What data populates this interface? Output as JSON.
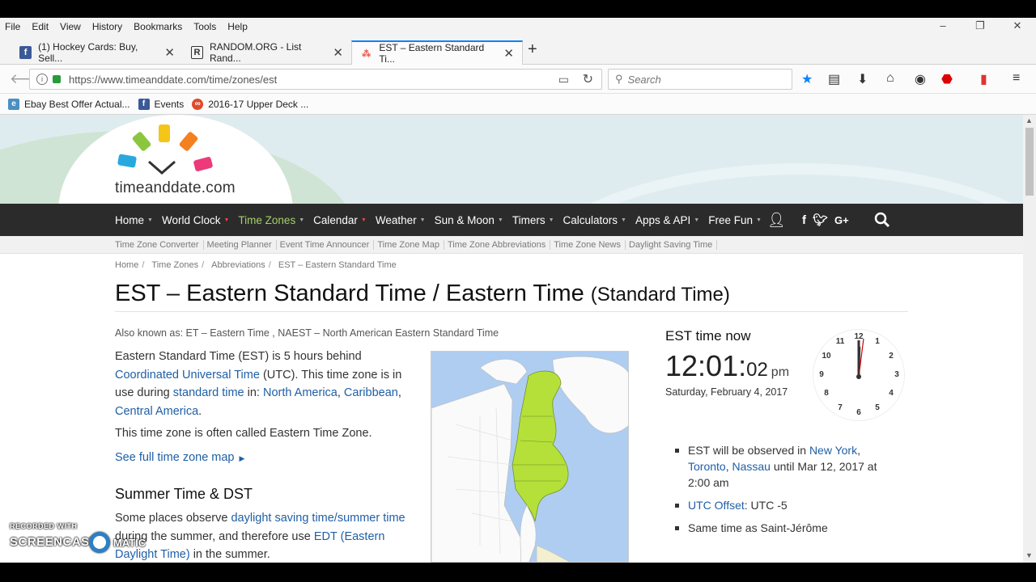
{
  "menubar": {
    "items": [
      "File",
      "Edit",
      "View",
      "History",
      "Bookmarks",
      "Tools",
      "Help"
    ]
  },
  "window_controls": {
    "minimize": "–",
    "restore": "❐",
    "close": "✕"
  },
  "tabs": [
    {
      "label": "(1) Hockey Cards: Buy, Sell...",
      "favicon": "facebook-icon"
    },
    {
      "label": "RANDOM.ORG - List Rand...",
      "favicon": "random-org-icon"
    },
    {
      "label": "EST – Eastern Standard Ti...",
      "favicon": "timeanddate-icon",
      "active": true
    }
  ],
  "navbar": {
    "url": "https://www.timeanddate.com/time/zones/est",
    "search_placeholder": "Search"
  },
  "bookmarks": [
    {
      "label": "Ebay Best Offer Actual...",
      "icon": "ebay-icon"
    },
    {
      "label": "Events",
      "icon": "facebook-icon"
    },
    {
      "label": "2016-17 Upper Deck ...",
      "icon": "upper-deck-icon"
    }
  ],
  "site": {
    "logo_text": "timeanddate.com",
    "nav": [
      {
        "label": "Home"
      },
      {
        "label": "World Clock"
      },
      {
        "label": "Time Zones",
        "active": true
      },
      {
        "label": "Calendar"
      },
      {
        "label": "Weather"
      },
      {
        "label": "Sun & Moon"
      },
      {
        "label": "Timers"
      },
      {
        "label": "Calculators"
      },
      {
        "label": "Apps & API"
      },
      {
        "label": "Free Fun"
      }
    ],
    "subnav": [
      "Time Zone Converter",
      "Meeting Planner",
      "Event Time Announcer",
      "Time Zone Map",
      "Time Zone Abbreviations",
      "Time Zone News",
      "Daylight Saving Time"
    ]
  },
  "breadcrumbs": [
    "Home",
    "Time Zones",
    "Abbreviations",
    "EST – Eastern Standard Time"
  ],
  "page": {
    "title": "EST – Eastern Standard Time / Eastern Time",
    "title_sub": "(Standard Time)",
    "aka": "Also known as: ET – Eastern Time , NAEST – North American Eastern Standard Time",
    "intro_1": "Eastern Standard Time (EST) is 5 hours behind",
    "intro_link_utc": "Coordinated Universal Time",
    "intro_2": " (UTC). This time zone is in use during ",
    "intro_link_std": "standard time",
    "intro_3": " in: ",
    "intro_link_na": "North America",
    "intro_comma1": ", ",
    "intro_link_car": "Caribbean",
    "intro_comma2": ",",
    "intro_link_ca": "Central America",
    "intro_period": ".",
    "often_called": "This time zone is often called Eastern Time Zone.",
    "see_map": "See full time zone map",
    "summer_heading": "Summer Time & DST",
    "summer_1": "Some places observe ",
    "summer_link_dst": "daylight saving time/summer time",
    "summer_2": " during the summer, and therefore use ",
    "summer_link_edt": "EDT (Eastern Daylight Time)",
    "summer_3": " in the summer."
  },
  "clock": {
    "label": "EST time now",
    "hm": "12:01:",
    "sec": "02",
    "ampm": "pm",
    "date": "Saturday, February 4, 2017",
    "numbers": [
      "12",
      "1",
      "2",
      "3",
      "4",
      "5",
      "6",
      "7",
      "8",
      "9",
      "10",
      "11"
    ]
  },
  "facts": {
    "observed_1": "EST will be observed in ",
    "observed_link_ny": "New York",
    "observed_comma1": ",",
    "observed_link_tor": "Toronto",
    "observed_comma2": ", ",
    "observed_link_nas": "Nassau",
    "observed_2": " until Mar 12, 2017 at 2:00 am",
    "utc_link": "UTC Offset",
    "utc_value": ": UTC -5",
    "same_time": "Same time as Saint-Jérôme"
  },
  "watermark": {
    "recorded": "RECORDED WITH",
    "brand": "SCREENCAST",
    "brand2": "MATIC"
  }
}
